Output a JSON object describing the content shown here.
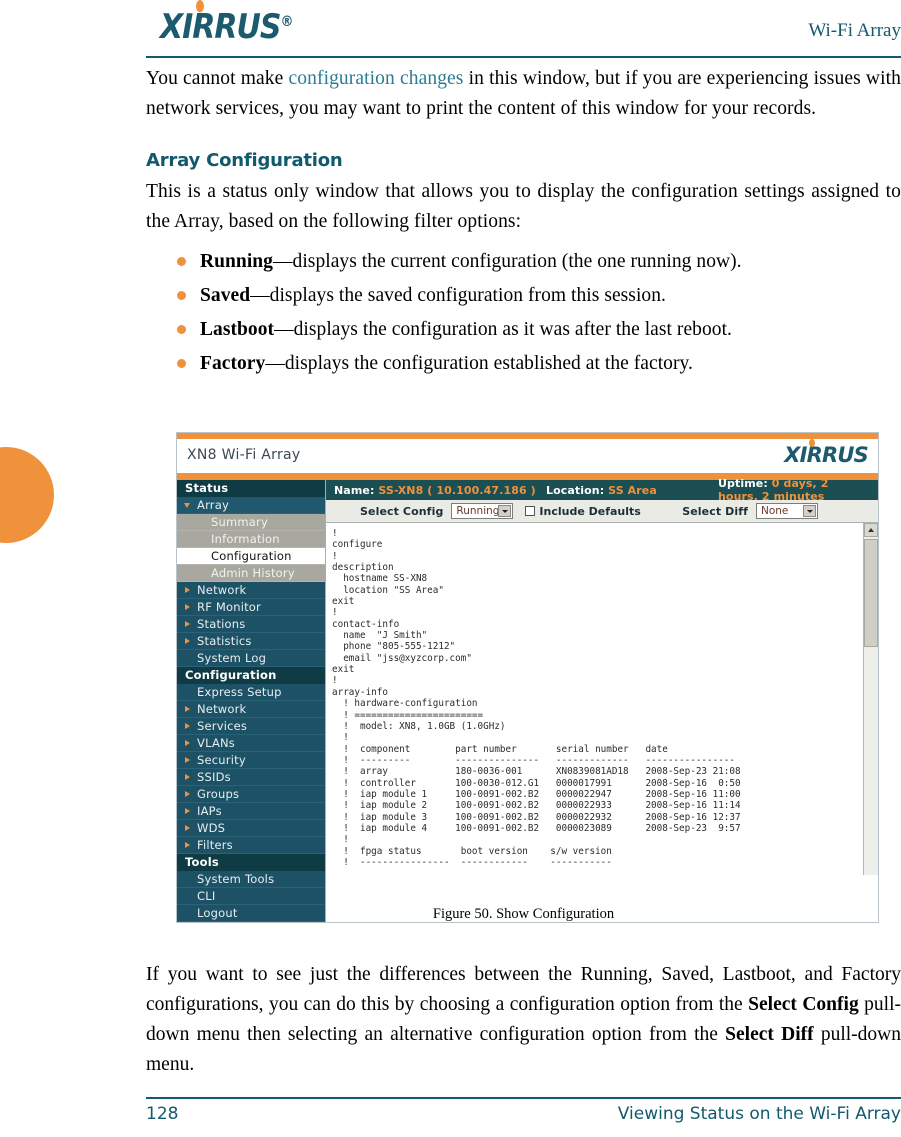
{
  "header": {
    "logo_text": "XIRRUS",
    "logo_reg": "®",
    "right_title": "Wi-Fi Array"
  },
  "intro_paragraph": {
    "before_link": "You cannot make ",
    "link_text": "configuration changes",
    "after_link": " in this window, but if you are experiencing issues with network services, you may want to print the content of this window for your records."
  },
  "section": {
    "heading": "Array Configuration",
    "paragraph": "This is a status only window that allows you to display the configuration settings assigned to the Array, based on the following filter options:"
  },
  "bullets": [
    {
      "term": "Running",
      "desc": "—displays the current configuration (the one running now)."
    },
    {
      "term": "Saved",
      "desc": "—displays the saved configuration from this session."
    },
    {
      "term": "Lastboot",
      "desc": "—displays the configuration as it was after the last reboot."
    },
    {
      "term": "Factory",
      "desc": "—displays the configuration established at the factory."
    }
  ],
  "screenshot": {
    "app_title": "XN8 Wi-Fi Array",
    "app_logo": "XIRRUS",
    "status_bar": {
      "name_label": "Name:",
      "name_value": "SS-XN8",
      "name_ip": "( 10.100.47.186 )",
      "location_label": "Location:",
      "location_value": "SS Area",
      "uptime_label": "Uptime:",
      "uptime_value": "0 days, 2 hours, 2 minutes"
    },
    "controls": {
      "select_config_label": "Select Config",
      "select_config_value": "Running",
      "include_defaults_label": "Include Defaults",
      "include_defaults_checked": false,
      "select_diff_label": "Select Diff",
      "select_diff_value": "None"
    },
    "sidebar": {
      "status_header": "Status",
      "status_items": [
        {
          "label": "Array",
          "type": "expanded"
        },
        {
          "label": "Summary",
          "type": "sub"
        },
        {
          "label": "Information",
          "type": "sub"
        },
        {
          "label": "Configuration",
          "type": "sub-active"
        },
        {
          "label": "Admin History",
          "type": "sub"
        },
        {
          "label": "Network",
          "type": "collapsed"
        },
        {
          "label": "RF Monitor",
          "type": "collapsed"
        },
        {
          "label": "Stations",
          "type": "collapsed"
        },
        {
          "label": "Statistics",
          "type": "collapsed"
        },
        {
          "label": "System Log",
          "type": "plain"
        }
      ],
      "configuration_header": "Configuration",
      "configuration_items": [
        {
          "label": "Express Setup",
          "type": "plain"
        },
        {
          "label": "Network",
          "type": "collapsed"
        },
        {
          "label": "Services",
          "type": "collapsed"
        },
        {
          "label": "VLANs",
          "type": "collapsed"
        },
        {
          "label": "Security",
          "type": "collapsed"
        },
        {
          "label": "SSIDs",
          "type": "collapsed"
        },
        {
          "label": "Groups",
          "type": "collapsed"
        },
        {
          "label": "IAPs",
          "type": "collapsed"
        },
        {
          "label": "WDS",
          "type": "collapsed"
        },
        {
          "label": "Filters",
          "type": "collapsed"
        }
      ],
      "tools_header": "Tools",
      "tools_items": [
        {
          "label": "System Tools",
          "type": "plain"
        },
        {
          "label": "CLI",
          "type": "plain"
        },
        {
          "label": "Logout",
          "type": "plain"
        }
      ]
    },
    "config_text": "!\nconfigure\n!\ndescription\n  hostname SS-XN8\n  location \"SS Area\"\nexit\n!\ncontact-info\n  name  \"J Smith\"\n  phone \"805-555-1212\"\n  email \"jss@xyzcorp.com\"\nexit\n!\narray-info\n  ! hardware-configuration\n  ! =======================\n  !  model: XN8, 1.0GB (1.0GHz)\n  !\n  !  component        part number       serial number   date\n  !  ---------        ---------------   -------------   ----------------\n  !  array            180-0036-001      XN0839081AD18   2008-Sep-23 21:08\n  !  controller       100-0030-012.G1   0000017991      2008-Sep-16  0:50\n  !  iap module 1     100-0091-002.B2   0000022947      2008-Sep-16 11:00\n  !  iap module 2     100-0091-002.B2   0000022933      2008-Sep-16 11:14\n  !  iap module 3     100-0091-002.B2   0000022932      2008-Sep-16 12:37\n  !  iap module 4     100-0091-002.B2   0000023089      2008-Sep-23  9:57\n  !\n  !  fpga status       boot version    s/w version\n  !  ----------------  ------------    -----------"
  },
  "caption": "Figure 50. Show Configuration",
  "bottom_paragraph": {
    "part1": "If you want to see just the differences between the Running, Saved, Lastboot, and Factory configurations, you can do this by choosing a configuration option from the ",
    "bold1": "Select Config",
    "part2": " pull-down menu then selecting an alternative configuration option from the ",
    "bold2": "Select Diff",
    "part3": " pull-down menu."
  },
  "footer": {
    "page_number": "128",
    "title": "Viewing Status on the Wi-Fi Array"
  }
}
